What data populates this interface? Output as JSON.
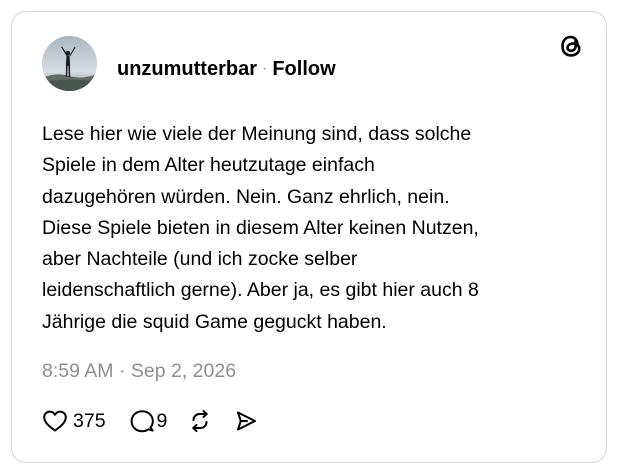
{
  "post": {
    "username": "unzumutterbar",
    "separator": "·",
    "follow_label": "Follow",
    "text": "Lese hier wie viele der Meinung sind, dass solche\nSpiele in dem Alter heutzutage einfach\ndazugehören würden. Nein. Ganz ehrlich, nein.\nDiese Spiele bieten in diesem Alter keinen Nutzen,\naber Nachteile (und ich zocke selber\nleidenschaftlich gerne). Aber ja, es gibt hier auch 8\nJährige die squid Game geguckt haben.",
    "timestamp": "8:59 AM · Sep 2, 2026"
  },
  "actions": {
    "likes": "375",
    "replies": "9"
  },
  "icons": {
    "logo": "threads-logo-icon",
    "like": "heart-icon",
    "reply": "comment-bubble-icon",
    "repost": "repost-arrows-icon",
    "share": "send-icon"
  },
  "colors": {
    "text": "#000000",
    "muted": "#8e8e8e",
    "border": "#d6d6d6"
  }
}
